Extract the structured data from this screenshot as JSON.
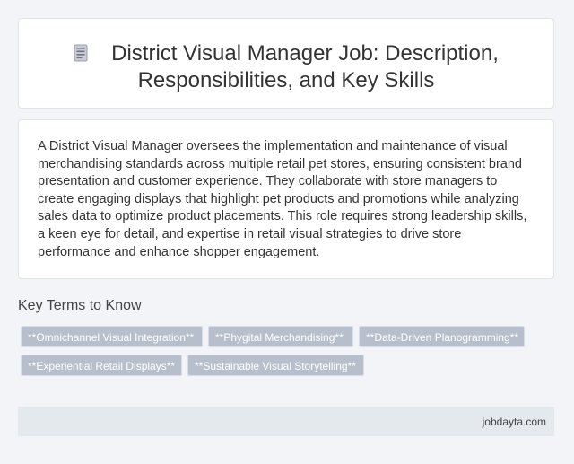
{
  "header": {
    "title_line1": "District Visual Manager Job: Description,",
    "title_line2": "Responsibilities, and Key Skills",
    "icon": "document-icon"
  },
  "description": {
    "text": "A District Visual Manager oversees the implementation and maintenance of visual merchandising standards across multiple retail pet stores, ensuring consistent brand presentation and customer experience. They collaborate with store managers to create engaging displays that highlight pet products and promotions while analyzing sales data to optimize product placements. This role requires strong leadership skills, a keen eye for detail, and expertise in retail visual strategies to drive store performance and enhance shopper engagement."
  },
  "key_terms": {
    "heading": "Key Terms to Know",
    "items": [
      "**Omnichannel Visual Integration**",
      "**Phygital Merchandising**",
      "**Data-Driven Planogramming**",
      "**Experiential Retail Displays**",
      "**Sustainable Visual Storytelling**"
    ]
  },
  "footer": {
    "site": "jobdayta.com"
  },
  "colors": {
    "background": "#f2f4f7",
    "tag_bg": "#b8bfcc",
    "footer_bg": "#e4e9ee"
  }
}
